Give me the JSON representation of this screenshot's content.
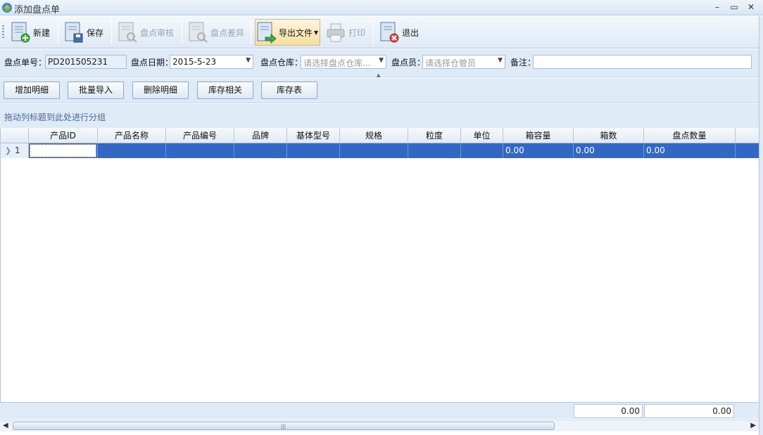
{
  "window": {
    "title": "添加盘点单",
    "minimize": "–",
    "maximize": "▭",
    "close": "✕"
  },
  "toolbar": {
    "new_label": "新建",
    "save_label": "保存",
    "audit_label": "盘点审核",
    "diff_label": "盘点差异",
    "export_label": "导出文件",
    "print_label": "打印",
    "exit_label": "退出"
  },
  "form": {
    "order_no_label": "盘点单号：",
    "order_no_value": "PD201505231",
    "date_label": "盘点日期：",
    "date_value": "2015-5-23",
    "warehouse_label": "盘点仓库：",
    "warehouse_placeholder": "请选择盘点仓库...",
    "clerk_label": "盘点员：",
    "clerk_placeholder": "请选择仓管员",
    "remark_label": "备注：",
    "remark_value": ""
  },
  "actions": {
    "add_detail": "增加明细",
    "batch_import": "批量导入",
    "delete_detail": "删除明细",
    "stock_related": "库存相关",
    "stock_table": "库存表"
  },
  "group_hint": "拖动列标题到此处进行分组",
  "grid": {
    "columns": [
      "产品ID",
      "产品名称",
      "产品编号",
      "品牌",
      "基体型号",
      "规格",
      "粒度",
      "单位",
      "箱容量",
      "箱数",
      "盘点数量"
    ],
    "rows": [
      {
        "index": "1",
        "cells": [
          "",
          "",
          "",
          "",
          "",
          "",
          "",
          "",
          "0.00",
          "0.00",
          "0.00"
        ]
      }
    ]
  },
  "footer": {
    "sum_boxes": "0.00",
    "sum_qty": "0.00"
  }
}
